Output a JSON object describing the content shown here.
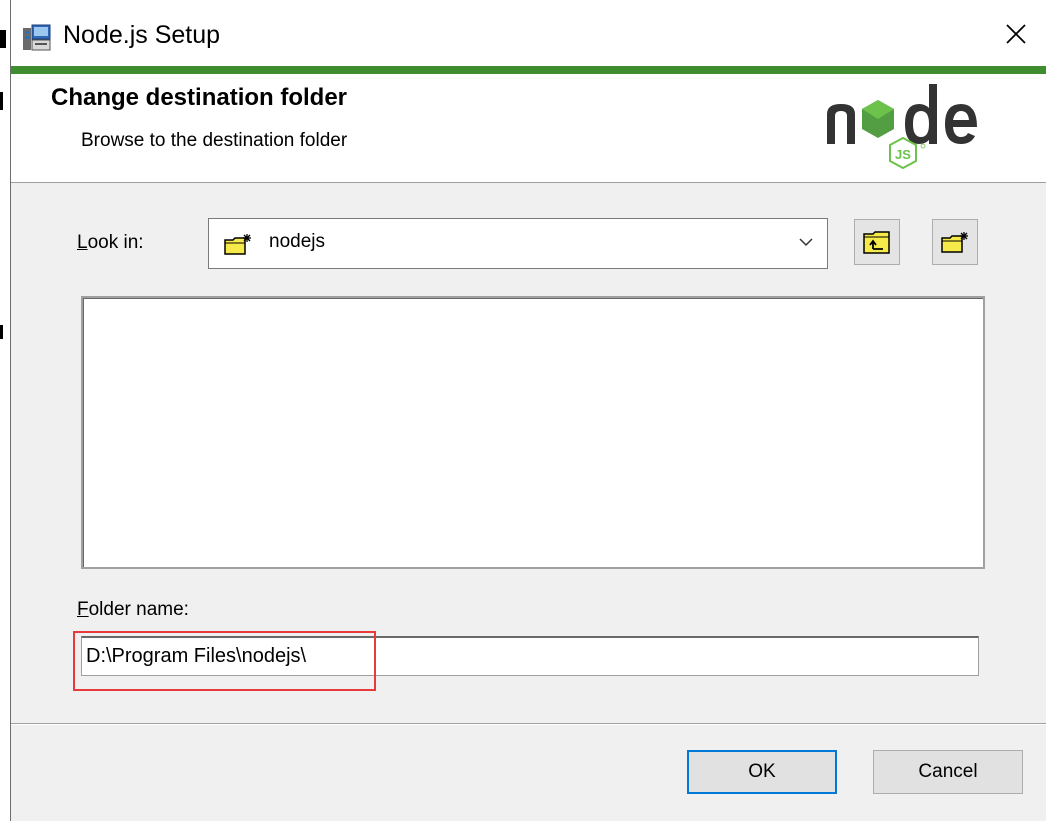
{
  "window": {
    "title": "Node.js Setup",
    "close_icon": "close-icon",
    "accent_color": "#3e8e2f"
  },
  "header": {
    "title": "Change destination folder",
    "subtitle": "Browse to the destination folder",
    "logo_text": "node",
    "logo_badge": "JS"
  },
  "look_in": {
    "label_first": "L",
    "label_rest": "ook in:",
    "selected": "nodejs",
    "icon": "new-folder-icon"
  },
  "toolbar": {
    "up_icon": "folder-up-icon",
    "new_icon": "new-folder-icon"
  },
  "folder_name": {
    "label_first": "F",
    "label_rest": "older name:",
    "value": "D:\\Program Files\\nodejs\\"
  },
  "buttons": {
    "ok": "OK",
    "cancel": "Cancel"
  }
}
